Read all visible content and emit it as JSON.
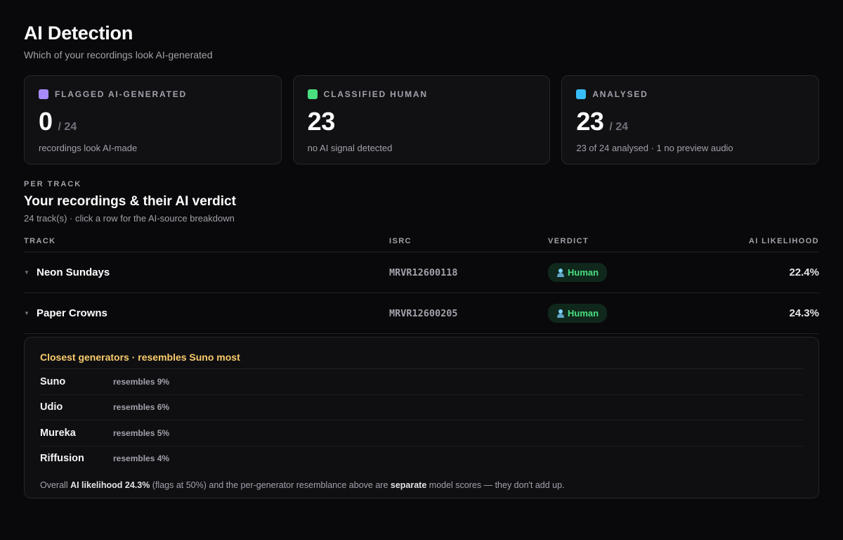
{
  "header": {
    "title": "AI Detection",
    "subtitle": "Which of your recordings look AI-generated"
  },
  "stats": [
    {
      "label": "FLAGGED AI-GENERATED",
      "color": "#a78bfa",
      "value": "0",
      "total": "/ 24",
      "desc": "recordings look AI-made"
    },
    {
      "label": "CLASSIFIED HUMAN",
      "color": "#4ade80",
      "value": "23",
      "total": "",
      "desc": "no AI signal detected"
    },
    {
      "label": "ANALYSED",
      "color": "#38bdf8",
      "value": "23",
      "total": "/ 24",
      "desc": "23 of 24 analysed · 1 no preview audio"
    }
  ],
  "section": {
    "eyebrow": "PER TRACK",
    "title": "Your recordings & their AI verdict",
    "subtitle": "24 track(s) · click a row for the AI-source breakdown"
  },
  "table": {
    "columns": {
      "track": "TRACK",
      "isrc": "ISRC",
      "verdict": "VERDICT",
      "ai": "AI LIKELIHOOD"
    },
    "rows": [
      {
        "caret": "▼",
        "name": "Neon Sundays",
        "isrc": "MRVR12600118",
        "verdict": "Human",
        "ai": "22.4%"
      },
      {
        "caret": "▼",
        "name": "Paper Crowns",
        "isrc": "MRVR12600205",
        "verdict": "Human",
        "ai": "24.3%"
      }
    ]
  },
  "breakdown": {
    "title": "Closest generators · resembles Suno most",
    "generators": [
      {
        "name": "Suno",
        "resembles": "resembles 9%"
      },
      {
        "name": "Udio",
        "resembles": "resembles 6%"
      },
      {
        "name": "Mureka",
        "resembles": "resembles 5%"
      },
      {
        "name": "Riffusion",
        "resembles": "resembles 4%"
      }
    ],
    "note": {
      "prefix": "Overall ",
      "ai_bold": "AI likelihood 24.3%",
      "middle": " (flags at 50%) and the per-generator resemblance above are ",
      "separate_bold": "separate",
      "suffix": " model scores — they don't add up."
    }
  }
}
